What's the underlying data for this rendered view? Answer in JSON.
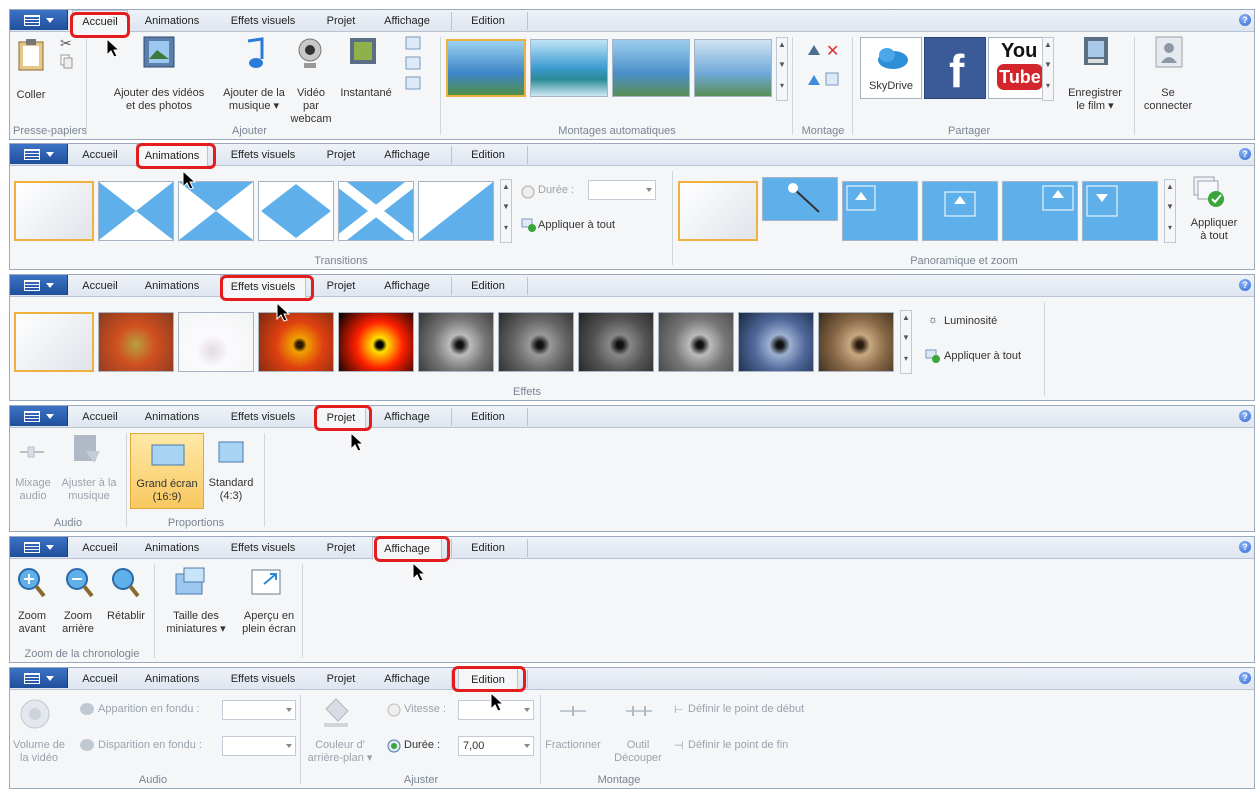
{
  "tabs": [
    "Accueil",
    "Animations",
    "Effets visuels",
    "Projet",
    "Affichage",
    "Edition"
  ],
  "help": "?",
  "accueil": {
    "presse_papiers": {
      "label": "Presse-papiers",
      "coller": "Coller"
    },
    "ajouter": {
      "label": "Ajouter",
      "videos": [
        "Ajouter des vidéos",
        "et des photos"
      ],
      "musique": [
        "Ajouter de la",
        "musique ▾"
      ],
      "webcam": [
        "Vidéo par",
        "webcam"
      ],
      "instantane": "Instantané"
    },
    "montages_label": "Montages automatiques",
    "montage_label": "Montage",
    "partager": {
      "label": "Partager",
      "skydrive": "SkyDrive",
      "youtube_top": "You",
      "youtube_bottom": "Tube",
      "facebook": "f"
    },
    "enregistrer": [
      "Enregistrer",
      "le film ▾"
    ],
    "connecter": [
      "Se",
      "connecter"
    ]
  },
  "animations": {
    "transitions_label": "Transitions",
    "duree": "Durée :",
    "appliquer_tout": "Appliquer à tout",
    "panoramique_label": "Panoramique et zoom",
    "appliquer": [
      "Appliquer",
      "à tout"
    ]
  },
  "effets": {
    "label": "Effets",
    "luminosite": "Luminosité",
    "appliquer_tout": "Appliquer à tout"
  },
  "projet": {
    "mixage": [
      "Mixage",
      "audio"
    ],
    "ajuster": [
      "Ajuster à la",
      "musique"
    ],
    "audio_label": "Audio",
    "grand_ecran": [
      "Grand écran",
      "(16:9)"
    ],
    "standard": [
      "Standard",
      "(4:3)"
    ],
    "proportions_label": "Proportions"
  },
  "affichage": {
    "zoom_avant": [
      "Zoom",
      "avant"
    ],
    "zoom_arriere": [
      "Zoom",
      "arrière"
    ],
    "retablir": "Rétablir",
    "taille": [
      "Taille des",
      "miniatures ▾"
    ],
    "apercu": [
      "Aperçu en",
      "plein écran"
    ],
    "zoom_label": "Zoom de la chronologie"
  },
  "edition": {
    "volume": [
      "Volume de",
      "la vidéo"
    ],
    "apparition": "Apparition en fondu :",
    "disparition": "Disparition en fondu :",
    "audio_label": "Audio",
    "couleur": [
      "Couleur d'",
      "arrière-plan ▾"
    ],
    "vitesse": "Vitesse :",
    "duree": "Durée :",
    "duree_value": "7,00",
    "ajuster_label": "Ajuster",
    "fractionner": "Fractionner",
    "outil": [
      "Outil",
      "Découper"
    ],
    "debut": "Définir le point de début",
    "fin": "Définir le point de fin",
    "montage_label": "Montage"
  },
  "colors": {
    "highlight": "#e41c1c",
    "file_button": "#2a5db0",
    "selected_thumb": "#f0b040"
  }
}
